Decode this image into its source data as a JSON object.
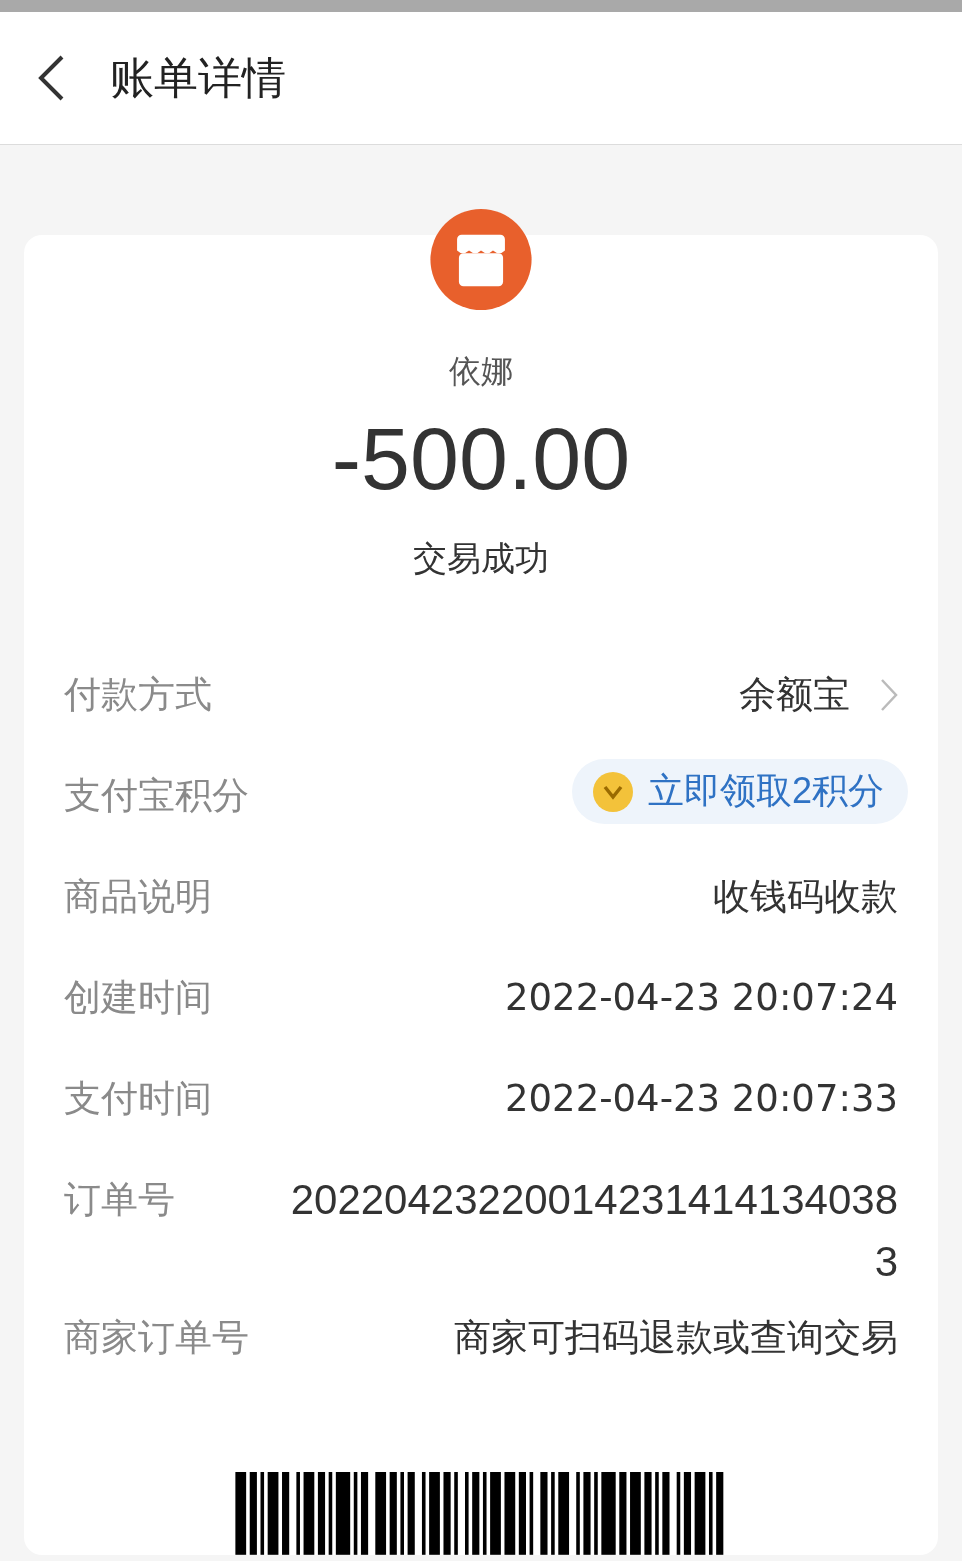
{
  "header": {
    "title": "账单详情"
  },
  "merchant": {
    "name": "依娜",
    "amount": "-500.00",
    "status": "交易成功"
  },
  "rows": [
    {
      "kind": "link",
      "label": "付款方式",
      "value": "余额宝"
    },
    {
      "kind": "points",
      "label": "支付宝积分",
      "value": "立即领取2积分"
    },
    {
      "kind": "text",
      "label": "商品说明",
      "value": "收钱码收款"
    },
    {
      "kind": "text",
      "label": "创建时间",
      "value": "2022-04-23 20:07:24"
    },
    {
      "kind": "text",
      "label": "支付时间",
      "value": "2022-04-23 20:07:33"
    },
    {
      "kind": "wrap",
      "label": "订单号",
      "value": "202204232200142314141340383"
    },
    {
      "kind": "text",
      "label": "商家订单号",
      "value": "商家可扫码退款或查询交易"
    }
  ]
}
